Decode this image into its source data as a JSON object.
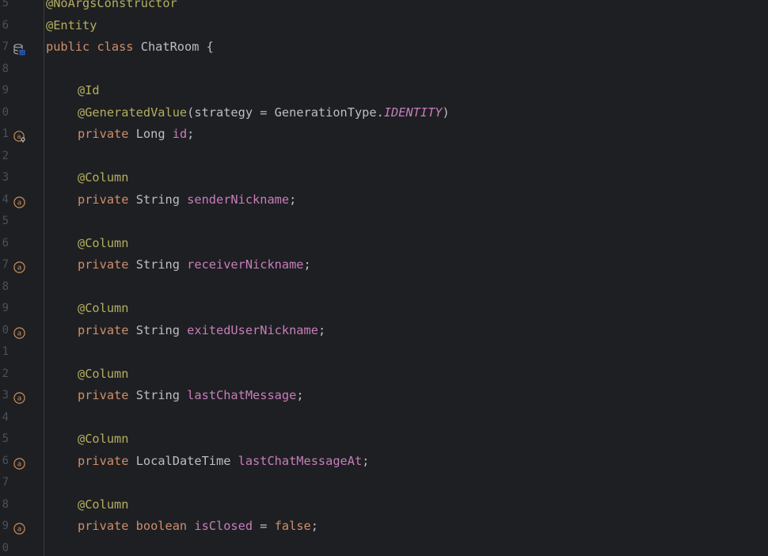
{
  "editor": {
    "lines": [
      {
        "num": "5",
        "gutter_icon": "",
        "indent": false,
        "tokens": [
          {
            "t": "ann",
            "v": "@NoArgsConstructor"
          }
        ]
      },
      {
        "num": "6",
        "gutter_icon": "",
        "indent": false,
        "tokens": [
          {
            "t": "ann",
            "v": "@Entity"
          }
        ]
      },
      {
        "num": "7",
        "gutter_icon": "database-entity-icon",
        "indent": false,
        "tokens": [
          {
            "t": "kw",
            "v": "public class "
          },
          {
            "t": "plain",
            "v": "ChatRoom {"
          }
        ]
      },
      {
        "num": "8",
        "gutter_icon": "",
        "indent": false,
        "tokens": []
      },
      {
        "num": "9",
        "gutter_icon": "",
        "indent": true,
        "tokens": [
          {
            "t": "ann",
            "v": "@Id"
          }
        ]
      },
      {
        "num": "0",
        "gutter_icon": "",
        "indent": true,
        "tokens": [
          {
            "t": "ann",
            "v": "@GeneratedValue"
          },
          {
            "t": "plain",
            "v": "(strategy = GenerationType."
          },
          {
            "t": "const",
            "v": "IDENTITY"
          },
          {
            "t": "plain",
            "v": ")"
          }
        ]
      },
      {
        "num": "1",
        "gutter_icon": "id-key-icon",
        "indent": true,
        "tokens": [
          {
            "t": "kw",
            "v": "private "
          },
          {
            "t": "plain",
            "v": "Long "
          },
          {
            "t": "fld",
            "v": "id"
          },
          {
            "t": "plain",
            "v": ";"
          }
        ]
      },
      {
        "num": "2",
        "gutter_icon": "",
        "indent": false,
        "tokens": []
      },
      {
        "num": "3",
        "gutter_icon": "",
        "indent": true,
        "tokens": [
          {
            "t": "ann",
            "v": "@Column"
          }
        ]
      },
      {
        "num": "4",
        "gutter_icon": "column-attribute-icon",
        "indent": true,
        "tokens": [
          {
            "t": "kw",
            "v": "private "
          },
          {
            "t": "plain",
            "v": "String "
          },
          {
            "t": "fld",
            "v": "senderNickname"
          },
          {
            "t": "plain",
            "v": ";"
          }
        ]
      },
      {
        "num": "5",
        "gutter_icon": "",
        "indent": false,
        "tokens": []
      },
      {
        "num": "6",
        "gutter_icon": "",
        "indent": true,
        "tokens": [
          {
            "t": "ann",
            "v": "@Column"
          }
        ]
      },
      {
        "num": "7",
        "gutter_icon": "column-attribute-icon",
        "indent": true,
        "tokens": [
          {
            "t": "kw",
            "v": "private "
          },
          {
            "t": "plain",
            "v": "String "
          },
          {
            "t": "fld",
            "v": "receiverNickname"
          },
          {
            "t": "plain",
            "v": ";"
          }
        ]
      },
      {
        "num": "8",
        "gutter_icon": "",
        "indent": false,
        "tokens": []
      },
      {
        "num": "9",
        "gutter_icon": "",
        "indent": true,
        "tokens": [
          {
            "t": "ann",
            "v": "@Column"
          }
        ]
      },
      {
        "num": "0",
        "gutter_icon": "column-attribute-icon",
        "indent": true,
        "tokens": [
          {
            "t": "kw",
            "v": "private "
          },
          {
            "t": "plain",
            "v": "String "
          },
          {
            "t": "fld",
            "v": "exitedUserNickname"
          },
          {
            "t": "plain",
            "v": ";"
          }
        ]
      },
      {
        "num": "1",
        "gutter_icon": "",
        "indent": false,
        "tokens": []
      },
      {
        "num": "2",
        "gutter_icon": "",
        "indent": true,
        "tokens": [
          {
            "t": "ann",
            "v": "@Column"
          }
        ]
      },
      {
        "num": "3",
        "gutter_icon": "column-attribute-icon",
        "indent": true,
        "tokens": [
          {
            "t": "kw",
            "v": "private "
          },
          {
            "t": "plain",
            "v": "String "
          },
          {
            "t": "fld",
            "v": "lastChatMessage"
          },
          {
            "t": "plain",
            "v": ";"
          }
        ]
      },
      {
        "num": "4",
        "gutter_icon": "",
        "indent": false,
        "tokens": []
      },
      {
        "num": "5",
        "gutter_icon": "",
        "indent": true,
        "tokens": [
          {
            "t": "ann",
            "v": "@Column"
          }
        ]
      },
      {
        "num": "6",
        "gutter_icon": "column-attribute-icon",
        "indent": true,
        "tokens": [
          {
            "t": "kw",
            "v": "private "
          },
          {
            "t": "plain",
            "v": "LocalDateTime "
          },
          {
            "t": "fld",
            "v": "lastChatMessageAt"
          },
          {
            "t": "plain",
            "v": ";"
          }
        ]
      },
      {
        "num": "7",
        "gutter_icon": "",
        "indent": false,
        "tokens": []
      },
      {
        "num": "8",
        "gutter_icon": "",
        "indent": true,
        "tokens": [
          {
            "t": "ann",
            "v": "@Column"
          }
        ]
      },
      {
        "num": "9",
        "gutter_icon": "column-attribute-icon",
        "indent": true,
        "tokens": [
          {
            "t": "kw",
            "v": "private boolean "
          },
          {
            "t": "fld",
            "v": "isClosed"
          },
          {
            "t": "plain",
            "v": " = "
          },
          {
            "t": "kw",
            "v": "false"
          },
          {
            "t": "plain",
            "v": ";"
          }
        ]
      },
      {
        "num": "0",
        "gutter_icon": "",
        "indent": false,
        "tokens": []
      }
    ]
  },
  "colors": {
    "background": "#1e1f22",
    "line_number": "#4b5059",
    "annotation": "#b3ae60",
    "keyword": "#cf8e6d",
    "field": "#c77dbb",
    "text": "#bcbec4"
  }
}
